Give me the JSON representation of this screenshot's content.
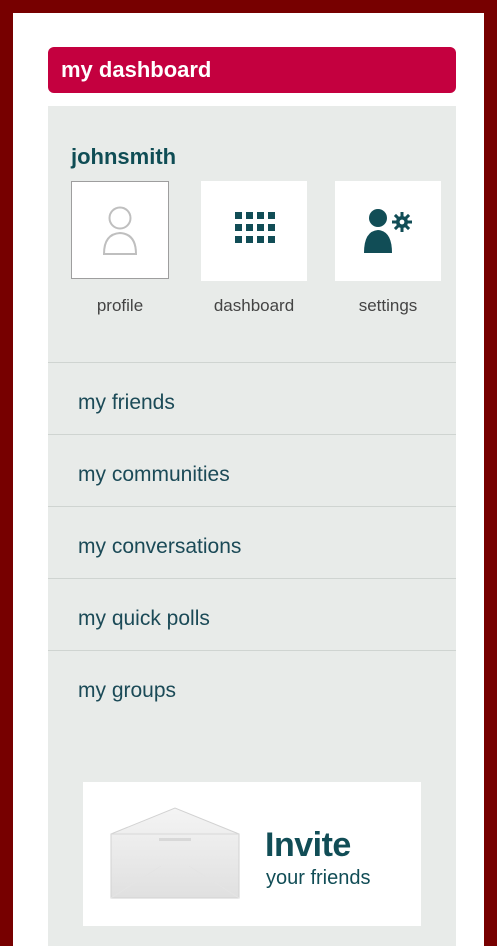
{
  "header": {
    "title": "my dashboard"
  },
  "user": {
    "name": "johnsmith"
  },
  "tiles": [
    {
      "label": "profile",
      "icon": "user-outline-icon"
    },
    {
      "label": "dashboard",
      "icon": "grid-icon"
    },
    {
      "label": "settings",
      "icon": "user-gear-icon"
    }
  ],
  "nav": {
    "items": [
      {
        "label": "my friends"
      },
      {
        "label": "my communities"
      },
      {
        "label": "my conversations"
      },
      {
        "label": "my quick polls"
      },
      {
        "label": "my groups"
      }
    ]
  },
  "invite": {
    "title": "Invite",
    "subtitle": "your friends"
  },
  "colors": {
    "frame": "#770000",
    "header_bg": "#c4003f",
    "panel_bg": "#e8ebe9",
    "accent": "#0f4d55"
  }
}
